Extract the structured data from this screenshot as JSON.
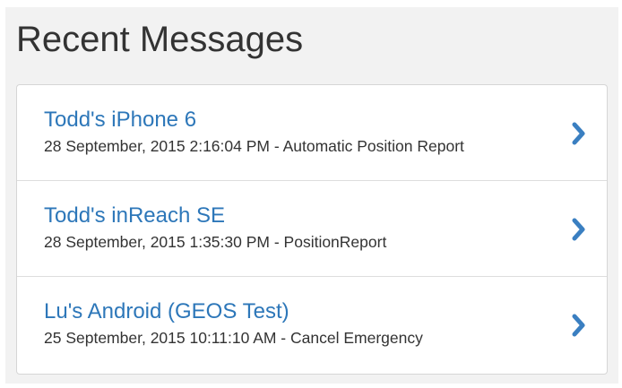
{
  "panel": {
    "title": "Recent Messages"
  },
  "messages": [
    {
      "device": "Todd's iPhone 6",
      "detail": "28 September, 2015 2:16:04 PM - Automatic Position Report",
      "icon": "chevron-right-icon"
    },
    {
      "device": "Todd's inReach SE",
      "detail": "28 September, 2015 1:35:30 PM - PositionReport",
      "icon": "chevron-right-icon"
    },
    {
      "device": "Lu's Android (GEOS Test)",
      "detail": "25 September, 2015 10:11:10 AM - Cancel Emergency",
      "icon": "chevron-right-icon"
    }
  ],
  "colors": {
    "link": "#2d77b9",
    "chevron": "#3a7fc1",
    "panel_background": "#f2f2f2"
  }
}
